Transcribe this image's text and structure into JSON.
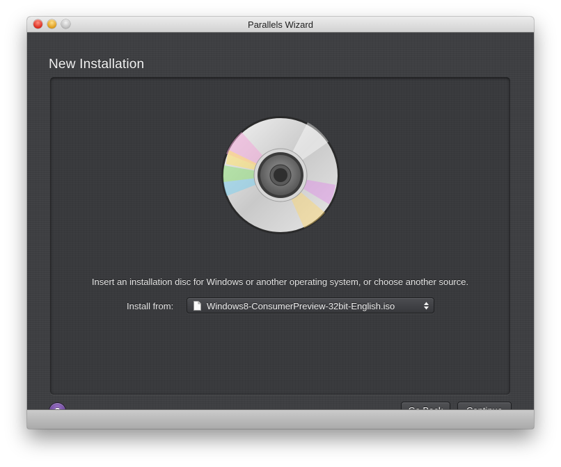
{
  "window": {
    "title": "Parallels Wizard"
  },
  "page": {
    "title": "New Installation"
  },
  "instructions": "Insert an installation disc for Windows or another operating system, or choose another source.",
  "install_from": {
    "label": "Install from:",
    "selected": "Windows8-ConsumerPreview-32bit-English.iso",
    "icon": "document-icon"
  },
  "footer": {
    "help_label": "?",
    "back_label": "Go Back",
    "continue_label": "Continue"
  },
  "icons": {
    "disc": "disc-icon",
    "popup_arrows": "chevron-updown-icon"
  },
  "colors": {
    "background_dark": "#3e3f42",
    "help_button": "#7b55a8",
    "title_bar": "#dedede"
  }
}
